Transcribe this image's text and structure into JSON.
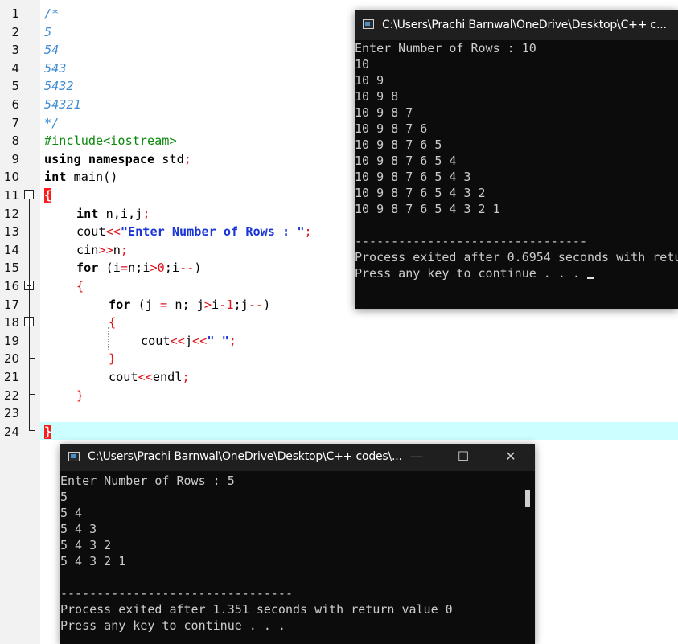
{
  "editor": {
    "line_numbers": [
      "1",
      "2",
      "3",
      "4",
      "5",
      "6",
      "7",
      "8",
      "9",
      "10",
      "11",
      "12",
      "13",
      "14",
      "15",
      "16",
      "17",
      "18",
      "19",
      "20",
      "21",
      "22",
      "23",
      "24"
    ],
    "code": {
      "l1": "/*",
      "l2": "5",
      "l3": "54",
      "l4": "543",
      "l5": "5432",
      "l6": "54321",
      "l7": "*/",
      "l8": "#include<iostream>",
      "l9_kw": "using namespace",
      "l9_rest": " std",
      "l10_kw": "int",
      "l10_rest": " main()",
      "brace_open": "{",
      "l12_kw": "int",
      "l12_rest": " n,i,j",
      "l13_a": "cout",
      "l13_str": "\"Enter Number of Rows : \"",
      "l14_a": "cin",
      "l14_b": "n",
      "l15_kw": "for",
      "l15_a": " (i",
      "l15_b": "n;i",
      "l15_num": "0",
      "l15_c": ";i",
      "l15_d": ")",
      "l16": "{",
      "l17_kw": "for",
      "l17_a": " (j ",
      "l17_b": " n; j",
      "l17_c": "i",
      "l17_num": "1",
      "l17_d": ";j",
      "l17_e": ")",
      "l18": "{",
      "l19_a": "cout",
      "l19_b": "j",
      "l19_str": "\" \"",
      "l20": "}",
      "l21_a": "cout",
      "l21_b": "endl",
      "l22": "}",
      "brace_close": "}"
    }
  },
  "console_large": {
    "title": "C:\\Users\\Prachi Barnwal\\OneDrive\\Desktop\\C++ c...",
    "lines": [
      "Enter Number of Rows : 10",
      "10",
      "10 9",
      "10 9 8",
      "10 9 8 7",
      "10 9 8 7 6",
      "10 9 8 7 6 5",
      "10 9 8 7 6 5 4",
      "10 9 8 7 6 5 4 3",
      "10 9 8 7 6 5 4 3 2",
      "10 9 8 7 6 5 4 3 2 1",
      "",
      "--------------------------------",
      "Process exited after 0.6954 seconds with retu",
      "Press any key to continue . . . "
    ]
  },
  "console_small": {
    "title": "C:\\Users\\Prachi Barnwal\\OneDrive\\Desktop\\C++ codes\\...",
    "minimize": "—",
    "maximize": "☐",
    "close": "✕",
    "lines": [
      "Enter Number of Rows : 5",
      "5",
      "5 4",
      "5 4 3",
      "5 4 3 2",
      "5 4 3 2 1",
      "",
      "--------------------------------",
      "Process exited after 1.351 seconds with return value 0",
      "Press any key to continue . . ."
    ]
  },
  "colors": {
    "comment": "#3f8bd0",
    "preprocessor": "#0a8a0a",
    "operator": "#e0141b",
    "string": "#1a36d6",
    "current_line": "#ccfdff",
    "console_bg": "#0c0c0c"
  }
}
